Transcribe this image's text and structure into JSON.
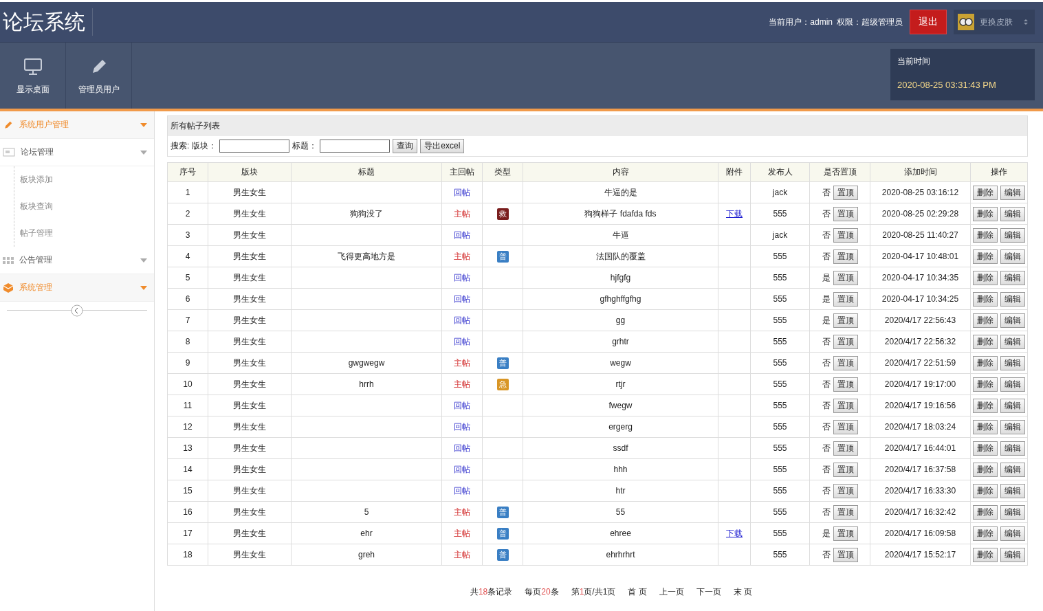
{
  "header": {
    "title": "论坛系统",
    "user_label": "当前用户：admin",
    "role_label": "权限：超级管理员",
    "logout": "退出",
    "skin": "更换皮肤"
  },
  "toolbar": [
    {
      "label": "显示桌面",
      "kind": "monitor"
    },
    {
      "label": "管理员用户",
      "kind": "pencil"
    }
  ],
  "clock": {
    "label": "当前时间",
    "value": "2020-08-25 03:31:43 PM"
  },
  "sidebar": {
    "items": [
      {
        "label": "系统用户管理",
        "kind": "pencil",
        "active": true
      },
      {
        "label": "论坛管理",
        "kind": "screen",
        "active": false,
        "children": [
          {
            "label": "板块添加"
          },
          {
            "label": "板块查询"
          },
          {
            "label": "帖子管理"
          }
        ]
      },
      {
        "label": "公告管理",
        "kind": "grid",
        "active": false
      },
      {
        "label": "系统管理",
        "kind": "box",
        "active": true
      }
    ]
  },
  "panel": {
    "title": "所有帖子列表",
    "search_label": "搜索:",
    "board_label": "版块：",
    "title_label": "标题：",
    "query": "查询",
    "export": "导出excel"
  },
  "table": {
    "columns": [
      "序号",
      "版块",
      "标题",
      "主回帖",
      "类型",
      "内容",
      "附件",
      "发布人",
      "是否置顶",
      "添加时间",
      "操作"
    ],
    "rows": [
      {
        "no": "1",
        "board": "男生女生",
        "title": "",
        "post": {
          "text": "回帖",
          "kind": "reply"
        },
        "content": "牛逼的是",
        "attachment": "",
        "author": "jack",
        "pinned": "否",
        "pin_button": "置顶",
        "time": "2020-08-25 03:16:12",
        "delete_button": "删除",
        "edit_button": "编辑"
      },
      {
        "no": "2",
        "board": "男生女生",
        "title": "狗狗没了",
        "post": {
          "text": "主帖",
          "kind": "main"
        },
        "badge": {
          "text": "救",
          "kind": "help"
        },
        "content": "狗狗样子 fdafda fds",
        "attachment": "下载",
        "author": "555",
        "pinned": "否",
        "pin_button": "置顶",
        "time": "2020-08-25 02:29:28",
        "delete_button": "删除",
        "edit_button": "编辑"
      },
      {
        "no": "3",
        "board": "男生女生",
        "title": "",
        "post": {
          "text": "回帖",
          "kind": "reply"
        },
        "content": "牛逼",
        "attachment": "",
        "author": "jack",
        "pinned": "否",
        "pin_button": "置顶",
        "time": "2020-08-25 11:40:27",
        "delete_button": "删除",
        "edit_button": "编辑"
      },
      {
        "no": "4",
        "board": "男生女生",
        "title": "飞得更高地方是",
        "post": {
          "text": "主帖",
          "kind": "main"
        },
        "badge": {
          "text": "普",
          "kind": "normal"
        },
        "content": "法国队的覆盖",
        "attachment": "",
        "author": "555",
        "pinned": "否",
        "pin_button": "置顶",
        "time": "2020-04-17 10:48:01",
        "delete_button": "删除",
        "edit_button": "编辑"
      },
      {
        "no": "5",
        "board": "男生女生",
        "title": "",
        "post": {
          "text": "回帖",
          "kind": "reply"
        },
        "content": "hjfgfg",
        "attachment": "",
        "author": "555",
        "pinned": "是",
        "pin_button": "置顶",
        "time": "2020-04-17 10:34:35",
        "delete_button": "删除",
        "edit_button": "编辑"
      },
      {
        "no": "6",
        "board": "男生女生",
        "title": "",
        "post": {
          "text": "回帖",
          "kind": "reply"
        },
        "content": "gfhghffgfhg",
        "attachment": "",
        "author": "555",
        "pinned": "是",
        "pin_button": "置顶",
        "time": "2020-04-17 10:34:25",
        "delete_button": "删除",
        "edit_button": "编辑"
      },
      {
        "no": "7",
        "board": "男生女生",
        "title": "",
        "post": {
          "text": "回帖",
          "kind": "reply"
        },
        "content": "gg",
        "attachment": "",
        "author": "555",
        "pinned": "是",
        "pin_button": "置顶",
        "time": "2020/4/17 22:56:43",
        "delete_button": "删除",
        "edit_button": "编辑"
      },
      {
        "no": "8",
        "board": "男生女生",
        "title": "",
        "post": {
          "text": "回帖",
          "kind": "reply"
        },
        "content": "grhtr",
        "attachment": "",
        "author": "555",
        "pinned": "否",
        "pin_button": "置顶",
        "time": "2020/4/17 22:56:32",
        "delete_button": "删除",
        "edit_button": "编辑"
      },
      {
        "no": "9",
        "board": "男生女生",
        "title": "gwgwegw",
        "post": {
          "text": "主帖",
          "kind": "main"
        },
        "badge": {
          "text": "普",
          "kind": "normal"
        },
        "content": "wegw",
        "attachment": "",
        "author": "555",
        "pinned": "否",
        "pin_button": "置顶",
        "time": "2020/4/17 22:51:59",
        "delete_button": "删除",
        "edit_button": "编辑"
      },
      {
        "no": "10",
        "board": "男生女生",
        "title": "hrrh",
        "post": {
          "text": "主帖",
          "kind": "main"
        },
        "badge": {
          "text": "急",
          "kind": "urgent"
        },
        "content": "rtjr",
        "attachment": "",
        "author": "555",
        "pinned": "否",
        "pin_button": "置顶",
        "time": "2020/4/17 19:17:00",
        "delete_button": "删除",
        "edit_button": "编辑"
      },
      {
        "no": "11",
        "board": "男生女生",
        "title": "",
        "post": {
          "text": "回帖",
          "kind": "reply"
        },
        "content": "fwegw",
        "attachment": "",
        "author": "555",
        "pinned": "否",
        "pin_button": "置顶",
        "time": "2020/4/17 19:16:56",
        "delete_button": "删除",
        "edit_button": "编辑"
      },
      {
        "no": "12",
        "board": "男生女生",
        "title": "",
        "post": {
          "text": "回帖",
          "kind": "reply"
        },
        "content": "ergerg",
        "attachment": "",
        "author": "555",
        "pinned": "否",
        "pin_button": "置顶",
        "time": "2020/4/17 18:03:24",
        "delete_button": "删除",
        "edit_button": "编辑"
      },
      {
        "no": "13",
        "board": "男生女生",
        "title": "",
        "post": {
          "text": "回帖",
          "kind": "reply"
        },
        "content": "ssdf",
        "attachment": "",
        "author": "555",
        "pinned": "否",
        "pin_button": "置顶",
        "time": "2020/4/17 16:44:01",
        "delete_button": "删除",
        "edit_button": "编辑"
      },
      {
        "no": "14",
        "board": "男生女生",
        "title": "",
        "post": {
          "text": "回帖",
          "kind": "reply"
        },
        "content": "hhh",
        "attachment": "",
        "author": "555",
        "pinned": "否",
        "pin_button": "置顶",
        "time": "2020/4/17 16:37:58",
        "delete_button": "删除",
        "edit_button": "编辑"
      },
      {
        "no": "15",
        "board": "男生女生",
        "title": "",
        "post": {
          "text": "回帖",
          "kind": "reply"
        },
        "content": "htr",
        "attachment": "",
        "author": "555",
        "pinned": "否",
        "pin_button": "置顶",
        "time": "2020/4/17 16:33:30",
        "delete_button": "删除",
        "edit_button": "编辑"
      },
      {
        "no": "16",
        "board": "男生女生",
        "title": "5",
        "post": {
          "text": "主帖",
          "kind": "main"
        },
        "badge": {
          "text": "普",
          "kind": "normal"
        },
        "content": "55",
        "attachment": "",
        "author": "555",
        "pinned": "否",
        "pin_button": "置顶",
        "time": "2020/4/17 16:32:42",
        "delete_button": "删除",
        "edit_button": "编辑"
      },
      {
        "no": "17",
        "board": "男生女生",
        "title": "ehr",
        "post": {
          "text": "主帖",
          "kind": "main"
        },
        "badge": {
          "text": "普",
          "kind": "normal"
        },
        "content": "ehree",
        "attachment": "下载",
        "author": "555",
        "pinned": "是",
        "pin_button": "置顶",
        "time": "2020/4/17 16:09:58",
        "delete_button": "删除",
        "edit_button": "编辑"
      },
      {
        "no": "18",
        "board": "男生女生",
        "title": "greh",
        "post": {
          "text": "主帖",
          "kind": "main"
        },
        "badge": {
          "text": "普",
          "kind": "normal"
        },
        "content": "ehrhrhrt",
        "attachment": "",
        "author": "555",
        "pinned": "否",
        "pin_button": "置顶",
        "time": "2020/4/17 15:52:17",
        "delete_button": "删除",
        "edit_button": "编辑"
      }
    ]
  },
  "pagination": {
    "groups": [
      [
        {
          "text": "共",
          "highlight": false
        },
        {
          "text": "18",
          "highlight": true
        },
        {
          "text": "条记录",
          "highlight": false
        }
      ],
      [
        {
          "text": "每页",
          "highlight": false
        },
        {
          "text": "20",
          "highlight": true
        },
        {
          "text": "条",
          "highlight": false
        }
      ],
      [
        {
          "text": "第",
          "highlight": false
        },
        {
          "text": "1",
          "highlight": true
        },
        {
          "text": "页/共1页",
          "highlight": false
        }
      ]
    ],
    "links": [
      "首 页",
      "上一页",
      "下一页",
      "末 页"
    ]
  }
}
